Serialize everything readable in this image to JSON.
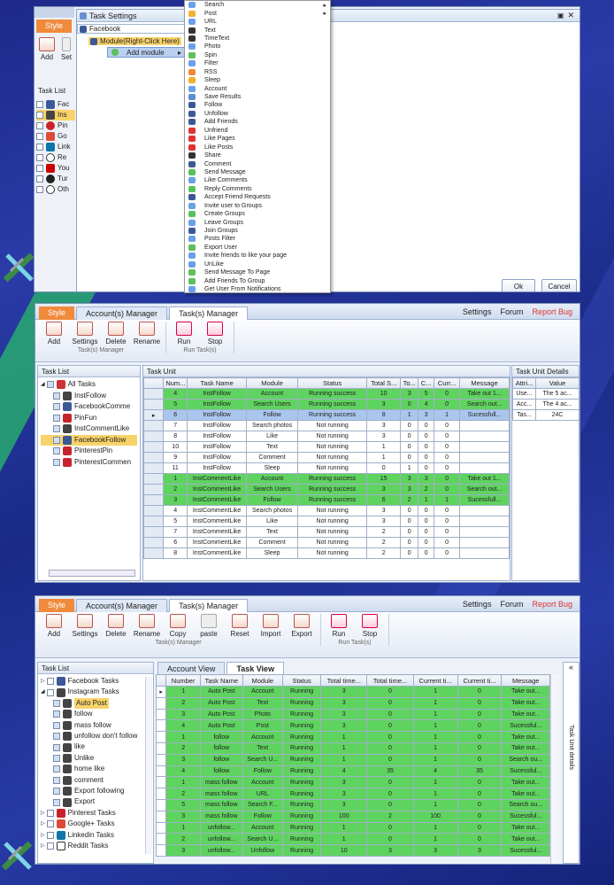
{
  "top": {
    "style_tab": "Style",
    "add": "Add",
    "set": "Set",
    "dialog_title": "Task Settings",
    "input_value": "Facebook",
    "module_node": "Module(Right-Click Here)",
    "add_module": "Add module",
    "tasklist": "Task List",
    "tree": [
      "Fac",
      "Ins",
      "Pin",
      "Go",
      "Link",
      "Re",
      "You",
      "Tur",
      "Oth"
    ],
    "ok": "Ok",
    "cancel": "Cancel",
    "menu": [
      "Search",
      "Post",
      "URL",
      "Text",
      "TimeText",
      "Photo",
      "Spin",
      "Filter",
      "RSS",
      "Sleep",
      "Account",
      "Save Results",
      "Follow",
      "Unfollow",
      "Add Friends",
      "Unfriend",
      "Like Pages",
      "Like Posts",
      "Share",
      "Comment",
      "Send Message",
      "Like Comments",
      "Reply Comments",
      "Accept Friend Requests",
      "Invite user to Groups",
      "Create Groups",
      "Leave Groups",
      "Join Groups",
      "Posts Filter",
      "Export User",
      "Invite friends to like your page",
      "UnLike",
      "Send Message To Page",
      "Add Friends To Group",
      "Get User From Notifications"
    ]
  },
  "mid": {
    "tabs": [
      "Style",
      "Account(s) Manager",
      "Task(s) Manager"
    ],
    "links": [
      "Settings",
      "Forum",
      "Report Bug"
    ],
    "buttons": [
      "Add",
      "Settings",
      "Delete",
      "Rename"
    ],
    "run_buttons": [
      "Run",
      "Stop"
    ],
    "group1": "Task(s) Manager",
    "group2": "Run Task(s)",
    "tasklist": "Task List",
    "taskunit": "Task Unit",
    "details": "Task Unit Details",
    "tree": [
      "All Tasks",
      "InstFollow",
      "FacebookComme",
      "PinFun",
      "InstCommentLike",
      "FacebookFollow",
      "PinterestPin",
      "PinterestCommen"
    ],
    "headers": [
      "Num...",
      "Task Name",
      "Module",
      "Status",
      "Total S...",
      "To...",
      "C...",
      "Curr...",
      "Message"
    ],
    "rows": [
      {
        "s": "g",
        "c": [
          "4",
          "InstFollow",
          "Account",
          "Running success",
          "10",
          "3",
          "5",
          "0",
          "Take out 1..."
        ]
      },
      {
        "s": "g",
        "c": [
          "5",
          "InstFollow",
          "Search Users",
          "Running success",
          "3",
          "0",
          "4",
          "0",
          "Search out..."
        ]
      },
      {
        "s": "sel",
        "c": [
          "6",
          "InstFollow",
          "Follow",
          "Running success",
          "8",
          "1",
          "3",
          "1",
          "Sucessfull..."
        ]
      },
      {
        "s": "w",
        "c": [
          "7",
          "InstFollow",
          "Search photos",
          "Not running",
          "3",
          "0",
          "0",
          "0",
          ""
        ]
      },
      {
        "s": "w",
        "c": [
          "8",
          "InstFollow",
          "Like",
          "Not running",
          "3",
          "0",
          "0",
          "0",
          ""
        ]
      },
      {
        "s": "w",
        "c": [
          "10",
          "InstFollow",
          "Text",
          "Not running",
          "1",
          "0",
          "0",
          "0",
          ""
        ]
      },
      {
        "s": "w",
        "c": [
          "9",
          "InstFollow",
          "Comment",
          "Not running",
          "1",
          "0",
          "0",
          "0",
          ""
        ]
      },
      {
        "s": "w",
        "c": [
          "11",
          "InstFollow",
          "Sleep",
          "Not running",
          "0",
          "1",
          "0",
          "0",
          ""
        ]
      },
      {
        "s": "g",
        "c": [
          "1",
          "InstCommentLike",
          "Account",
          "Running success",
          "15",
          "3",
          "3",
          "0",
          "Take out 1..."
        ]
      },
      {
        "s": "g",
        "c": [
          "2",
          "InstCommentLike",
          "Search Users",
          "Running success",
          "3",
          "3",
          "2",
          "0",
          "Search out..."
        ]
      },
      {
        "s": "g",
        "c": [
          "3",
          "InstCommentLike",
          "Follow",
          "Running success",
          "6",
          "2",
          "1",
          "1",
          "Sucessfull..."
        ]
      },
      {
        "s": "w",
        "c": [
          "4",
          "InstCommentLike",
          "Search photos",
          "Not running",
          "3",
          "0",
          "0",
          "0",
          ""
        ]
      },
      {
        "s": "w",
        "c": [
          "5",
          "InstCommentLike",
          "Like",
          "Not running",
          "3",
          "0",
          "0",
          "0",
          ""
        ]
      },
      {
        "s": "w",
        "c": [
          "7",
          "InstCommentLike",
          "Text",
          "Not running",
          "2",
          "0",
          "0",
          "0",
          ""
        ]
      },
      {
        "s": "w",
        "c": [
          "6",
          "InstCommentLike",
          "Comment",
          "Not running",
          "2",
          "0",
          "0",
          "0",
          ""
        ]
      },
      {
        "s": "w",
        "c": [
          "8",
          "InstCommentLike",
          "Sleep",
          "Not running",
          "2",
          "0",
          "0",
          "0",
          ""
        ]
      }
    ],
    "detail_headers": [
      "Attri...",
      "Value"
    ],
    "details_rows": [
      [
        "Use...",
        "The 5 ac..."
      ],
      [
        "Acc...",
        "The 4 ac..."
      ],
      [
        "Tas...",
        "24C"
      ]
    ]
  },
  "bot": {
    "tabs": [
      "Style",
      "Account(s) Manager",
      "Task(s) Manager"
    ],
    "links": [
      "Settings",
      "Forum",
      "Report Bug"
    ],
    "buttons": [
      "Add",
      "Settings",
      "Delete",
      "Rename",
      "Copy",
      "paste",
      "Reset",
      "Import",
      "Export"
    ],
    "run_buttons": [
      "Run",
      "Stop"
    ],
    "group1": "Task(s) Manager",
    "group2": "Run Task(s)",
    "tasklist": "Task List",
    "view_tabs": [
      "Account View",
      "Task View"
    ],
    "side": "Task Unit details",
    "tree": [
      "Facebook Tasks",
      "Instagram Tasks",
      "Auto Post",
      "follow",
      "mass follow",
      "unfollow don't follow",
      "like",
      "Unlike",
      "home like",
      "comment",
      "Export following",
      "Export",
      "Pinterest Tasks",
      "Google+ Tasks",
      "Linkedin Tasks",
      "Reddit Tasks"
    ],
    "headers": [
      "Number",
      "Task Name",
      "Module",
      "Status",
      "Total time...",
      "Total time...",
      "Current ti...",
      "Current ti...",
      "Message"
    ],
    "rows": [
      [
        "1",
        "Auto Post",
        "Account",
        "Running",
        "3",
        "0",
        "1",
        "0",
        "Take out..."
      ],
      [
        "2",
        "Auto Post",
        "Text",
        "Running",
        "3",
        "0",
        "1",
        "0",
        "Take out..."
      ],
      [
        "3",
        "Auto Post",
        "Photo",
        "Running",
        "3",
        "0",
        "1",
        "0",
        "Take out..."
      ],
      [
        "4",
        "Auto Post",
        "Post",
        "Running",
        "3",
        "0",
        "1",
        "0",
        "Sucessful..."
      ],
      [
        "1",
        "follow",
        "Account",
        "Running",
        "1",
        "0",
        "1",
        "0",
        "Take out..."
      ],
      [
        "2",
        "follow",
        "Text",
        "Running",
        "1",
        "0",
        "1",
        "0",
        "Take out..."
      ],
      [
        "3",
        "follow",
        "Search U...",
        "Running",
        "1",
        "0",
        "1",
        "0",
        "Search ou..."
      ],
      [
        "4",
        "follow",
        "Follow",
        "Running",
        "4",
        "35",
        "4",
        "35",
        "Sucessful..."
      ],
      [
        "1",
        "mass follow",
        "Account",
        "Running",
        "3",
        "0",
        "1",
        "0",
        "Take out..."
      ],
      [
        "2",
        "mass follow",
        "URL",
        "Running",
        "3",
        "0",
        "1",
        "0",
        "Take out..."
      ],
      [
        "5",
        "mass follow",
        "Search F...",
        "Running",
        "3",
        "0",
        "1",
        "0",
        "Search ou..."
      ],
      [
        "3",
        "mass follow",
        "Follow",
        "Running",
        "100",
        "2",
        "100",
        "0",
        "Sucessful..."
      ],
      [
        "1",
        "unfollow...",
        "Account",
        "Running",
        "1",
        "0",
        "1",
        "0",
        "Take out..."
      ],
      [
        "2",
        "unfollow...",
        "Search U...",
        "Running",
        "1",
        "0",
        "1",
        "0",
        "Take out..."
      ],
      [
        "3",
        "unfollow...",
        "Unfollow",
        "Running",
        "10",
        "3",
        "3",
        "3",
        "Sucessful..."
      ]
    ]
  },
  "colors": {
    "green": "#5fd35f",
    "accent": "#f08a3c",
    "select": "#a9c6ee"
  }
}
